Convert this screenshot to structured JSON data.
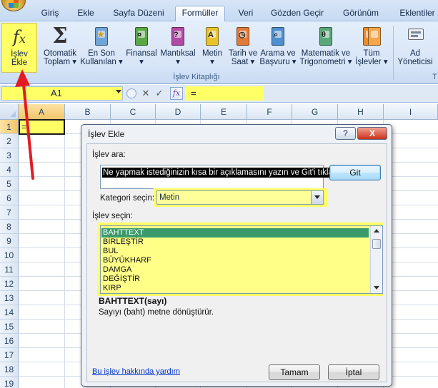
{
  "tabs": [
    "Giriş",
    "Ekle",
    "Sayfa Düzeni",
    "Formüller",
    "Veri",
    "Gözden Geçir",
    "Görünüm",
    "Eklentiler"
  ],
  "active_tab": "Formüller",
  "ribbon": {
    "insert_function": [
      "İşlev",
      "Ekle"
    ],
    "autosum": [
      "Otomatik",
      "Toplam ▾"
    ],
    "recent": [
      "En Son",
      "Kullanılan ▾"
    ],
    "financial": [
      "Finansal",
      "▾"
    ],
    "logical": [
      "Mantıksal",
      "▾"
    ],
    "text": [
      "Metin",
      "▾"
    ],
    "datetime": [
      "Tarih ve",
      "Saat ▾"
    ],
    "lookup": [
      "Arama ve",
      "Başvuru ▾"
    ],
    "math": [
      "Matematik ve",
      "Trigonometri ▾"
    ],
    "all_functions": [
      "Tüm",
      "İşlevler ▾"
    ],
    "name_manager": [
      "Ad",
      "Yöneticisi"
    ],
    "group_label": "İşlev Kitaplığı",
    "group_label_right": "T"
  },
  "formula_bar": {
    "name_box": "A1",
    "formula": "="
  },
  "grid": {
    "columns": [
      "A",
      "B",
      "C",
      "D",
      "E",
      "F",
      "G",
      "H",
      "I"
    ],
    "rows": [
      "1",
      "2",
      "3",
      "4",
      "5",
      "6",
      "7",
      "8",
      "9",
      "10",
      "11",
      "12",
      "13",
      "14",
      "15",
      "16",
      "17",
      "18",
      "19"
    ],
    "a1_value": "="
  },
  "dialog": {
    "title": "İşlev Ekle",
    "help_glyph": "?",
    "close_glyph": "X",
    "search_label": "İşlev ara:",
    "search_text": "Ne yapmak istediğinizin kısa bir açıklamasını yazın ve Git'i tıklatın",
    "go_button": "Git",
    "category_label": "Kategori seçin:",
    "category_value": "Metin",
    "function_label": "İşlev seçin:",
    "functions": [
      "BAHTTEXT",
      "BİRLEŞTİR",
      "BUL",
      "BÜYÜKHARF",
      "DAMGA",
      "DEĞİŞTİR",
      "KIRP"
    ],
    "selected_function": "BAHTTEXT",
    "signature": "BAHTTEXT(sayı)",
    "description": "Sayıyı (baht) metne dönüştürür.",
    "help_link": "Bu işlev hakkında yardım",
    "ok_button": "Tamam",
    "cancel_button": "İptal"
  },
  "colors": {
    "highlight_yellow": "#ffff66",
    "selected_row_green": "#3a9a6c",
    "annotation_arrow_red": "#e31b23"
  }
}
